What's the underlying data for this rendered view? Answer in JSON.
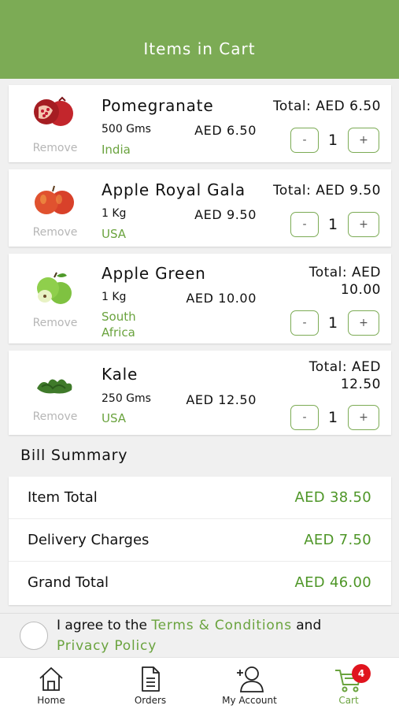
{
  "header": {
    "title": "Items in Cart"
  },
  "items": [
    {
      "name": "Pomegranate",
      "quantity": "500 Gms",
      "origin": "India",
      "price": "AED 6.50",
      "total_line1": "Total: AED 6.50",
      "total_line2": "",
      "count": "1",
      "remove": "Remove",
      "minus": "-",
      "plus": "+",
      "image": "pomegranate-image"
    },
    {
      "name": "Apple Royal Gala",
      "quantity": "1 Kg",
      "origin": "USA",
      "price": "AED 9.50",
      "total_line1": "Total: AED 9.50",
      "total_line2": "",
      "count": "1",
      "remove": "Remove",
      "minus": "-",
      "plus": "+",
      "image": "red-apple-image"
    },
    {
      "name": "Apple Green",
      "quantity": "1 Kg",
      "origin": "South Africa",
      "price": "AED 10.00",
      "total_line1": "Total: AED",
      "total_line2": "10.00",
      "count": "1",
      "remove": "Remove",
      "minus": "-",
      "plus": "+",
      "image": "green-apple-image"
    },
    {
      "name": "Kale",
      "quantity": "250 Gms",
      "origin": "USA",
      "price": "AED 12.50",
      "total_line1": "Total: AED",
      "total_line2": "12.50",
      "count": "1",
      "remove": "Remove",
      "minus": "-",
      "plus": "+",
      "image": "kale-image"
    }
  ],
  "bill": {
    "title": "Bill Summary",
    "rows": [
      {
        "label": "Item Total",
        "value": "AED 38.50"
      },
      {
        "label": "Delivery Charges",
        "value": "AED 7.50"
      },
      {
        "label": "Grand Total",
        "value": "AED 46.00"
      }
    ]
  },
  "agreement": {
    "prefix": "I agree to the ",
    "terms_link": "Terms & Conditions",
    "middle": " and",
    "privacy_link": "Privacy Policy"
  },
  "tabs": [
    {
      "label": "Home",
      "icon": "home-icon"
    },
    {
      "label": "Orders",
      "icon": "orders-icon"
    },
    {
      "label": "My Account",
      "icon": "add-user-icon"
    },
    {
      "label": "Cart",
      "icon": "cart-icon",
      "badge": "4",
      "active": true
    }
  ],
  "colors": {
    "accent": "#7cab55",
    "price_green": "#4e9627",
    "badge": "#e0141e"
  }
}
